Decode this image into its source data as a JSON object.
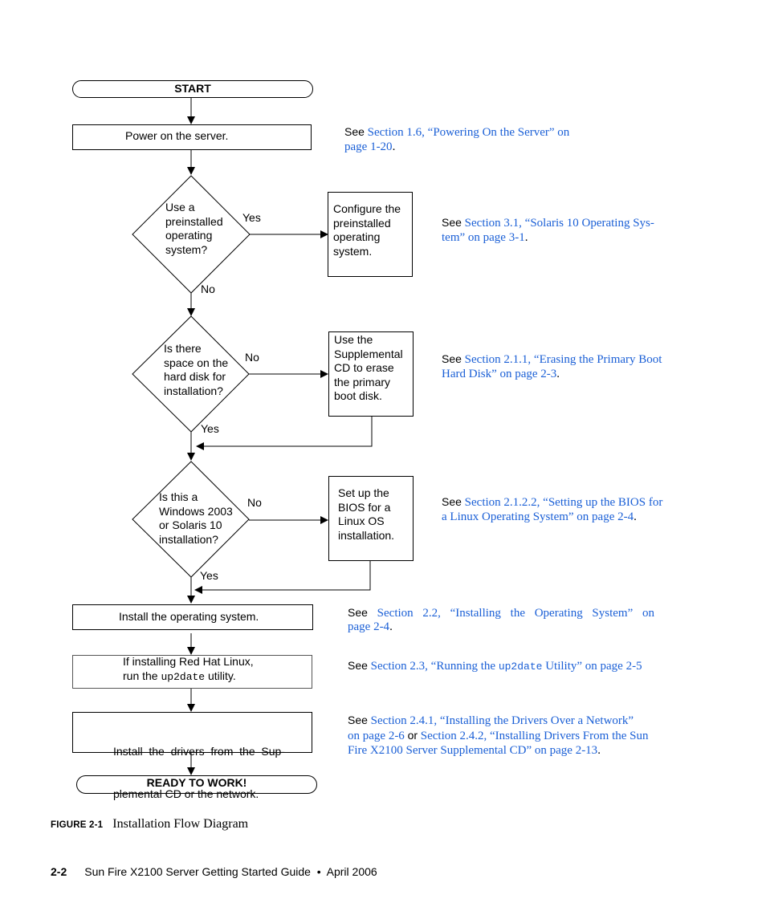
{
  "flowchart": {
    "start": "START",
    "end": "READY TO WORK!",
    "steps": {
      "power_on": "Power on the server.",
      "install_os": "Install the operating system.",
      "redhat_line1": "If installing Red Hat Linux,",
      "redhat_line2_pre": "run the ",
      "redhat_line2_code": "up2date",
      "redhat_line2_post": " utility.",
      "drivers_line1": "Install  the  drivers  from  the  Sup-",
      "drivers_line2": "plemental CD or the network."
    },
    "decisions": [
      {
        "lines": [
          "Use a",
          "preinstalled",
          "operating",
          "system?"
        ],
        "right_label": "Yes",
        "down_label": "No"
      },
      {
        "lines": [
          "Is there",
          "space on the",
          "hard disk for",
          "installation?"
        ],
        "right_label": "No",
        "down_label": "Yes"
      },
      {
        "lines": [
          "Is this a",
          "Windows 2003",
          "or Solaris 10",
          "installation?"
        ],
        "right_label": "No",
        "down_label": "Yes"
      }
    ],
    "side_boxes": [
      {
        "lines": [
          "Configure the",
          "preinstalled",
          "operating",
          "system."
        ]
      },
      {
        "lines": [
          "Use the",
          "Supplemental",
          "CD to erase",
          "the primary",
          "boot disk."
        ]
      },
      {
        "lines": [
          "Set up the",
          "BIOS for a",
          "Linux OS",
          "installation."
        ]
      }
    ]
  },
  "references": {
    "see": "See",
    "or": "or",
    "r1": {
      "link": "Section 1.6, “Powering On the Server” on page 1-20",
      "line1": "Section 1.6, “Powering On the Server” on",
      "line2": "page 1-20",
      "end": "."
    },
    "r2": {
      "line1": "Section 3.1, “Solaris 10 Operating Sys-",
      "line2": "tem” on page 3-1",
      "end": "."
    },
    "r3": {
      "line1": "Section 2.1.1, “Erasing the Primary Boot",
      "line2": "Hard Disk” on page 2-3",
      "end": "."
    },
    "r4": {
      "line1": "Section 2.1.2.2, “Setting up the BIOS for",
      "line2": "a Linux Operating System” on page 2-4",
      "end": "."
    },
    "r5": {
      "line1": "Section 2.2, “Installing the Operating System” on",
      "line2": "page 2-4",
      "end": "."
    },
    "r6": {
      "pre": "Section 2.3, “Running the ",
      "code": "up2date",
      "post": " Utility” on page 2-5"
    },
    "r7": {
      "link_a_line1": "Section 2.4.1, “Installing the Drivers Over a Network”",
      "link_a_line2": "on page 2-6",
      "link_b_line2": "Section 2.4.2, “Installing Drivers From the Sun",
      "link_b_line3": "Fire X2100 Server Supplemental CD” on page 2-13",
      "end": "."
    }
  },
  "caption": {
    "label": "FIGURE 2-1",
    "title": "Installation Flow Diagram"
  },
  "footer": {
    "page": "2-2",
    "text": "Sun Fire X2100 Server Getting Started Guide  •  April 2006"
  },
  "colors": {
    "link": "#1a5fd6",
    "line": "#000000"
  }
}
